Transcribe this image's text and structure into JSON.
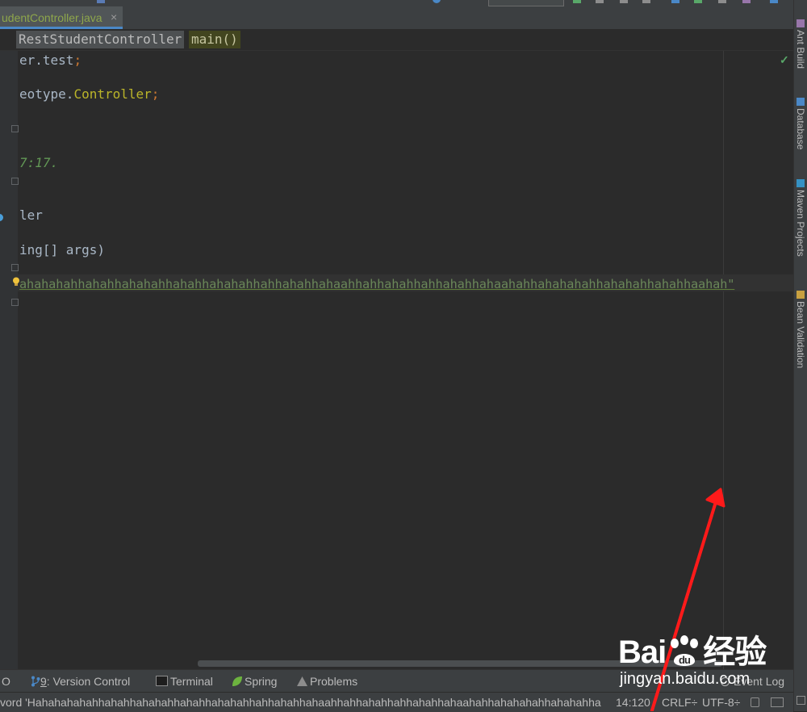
{
  "tab": {
    "label": "udentController.java",
    "close": "×"
  },
  "breadcrumb": {
    "class_name": "RestStudentController",
    "method_name": "main()"
  },
  "editor": {
    "lines": [
      {
        "a": "er.test",
        "b": ";"
      },
      {
        "a": "eotype.",
        "b": "Controller",
        "c": ";"
      },
      {
        "a": "7:17."
      },
      {
        "a": "ler"
      },
      {
        "a": "ing[] args)"
      },
      {
        "a": "ahahahahhahahhahahahhahahhahahahhahhahahhahaahhahhahahhahhahahhahaahahhahahahahhahahahhahahhaahah\""
      }
    ]
  },
  "right_tools": [
    "Ant Build",
    "Database",
    "Maven Projects",
    "Bean Validation"
  ],
  "bottom_tools": {
    "todo": "O",
    "vc_num": "9",
    "vc_label": ": Version Control",
    "terminal": "Terminal",
    "spring": "Spring",
    "problems": "Problems",
    "event_log": "Event Log"
  },
  "status": {
    "message": "vord 'Hahahahahahhahahhahahahhahahhahahahhahhahahhahaahhahhahahhahhahahhahaahahhahahahahhahahahhaha...",
    "position": "14:120",
    "line_sep": "CRLF",
    "line_sep_arrow": "÷",
    "encoding": "UTF-8",
    "encoding_arrow": "÷"
  },
  "watermark": {
    "text": "Bai",
    "paw": "du",
    "cn": "经验",
    "url": "jingyan.baidu.com"
  },
  "colors": {
    "accent": "#4a88c7",
    "annotation": "#ff1a1a",
    "string": "#6a8759",
    "class": "#cc7832"
  }
}
